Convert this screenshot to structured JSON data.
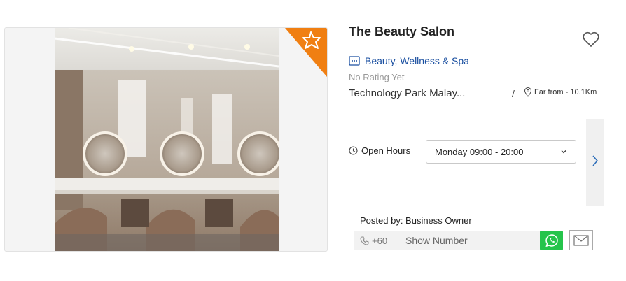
{
  "listing": {
    "title": "The Beauty Salon",
    "category": "Beauty, Wellness & Spa",
    "rating_text": "No Rating Yet",
    "address": "Technology Park Malay...",
    "separator": "/",
    "distance": "Far from - 10.1Km"
  },
  "hours": {
    "label": "Open Hours",
    "selected": "Monday 09:00 - 20:00"
  },
  "contact": {
    "posted_by": "Posted by: Business Owner",
    "phone_prefix": "+60",
    "show_number": "Show Number"
  },
  "icons": {
    "favorite": "heart-icon",
    "category": "category-icon",
    "location": "location-pin-icon",
    "clock": "clock-icon",
    "phone": "phone-icon",
    "whatsapp": "whatsapp-icon",
    "mail": "mail-icon",
    "next": "chevron-right-icon",
    "dropdown": "chevron-down-icon",
    "featured": "star-badge-icon"
  },
  "colors": {
    "accent_orange": "#f07f12",
    "link_blue": "#1a4fa0",
    "whatsapp_green": "#25c44b"
  }
}
